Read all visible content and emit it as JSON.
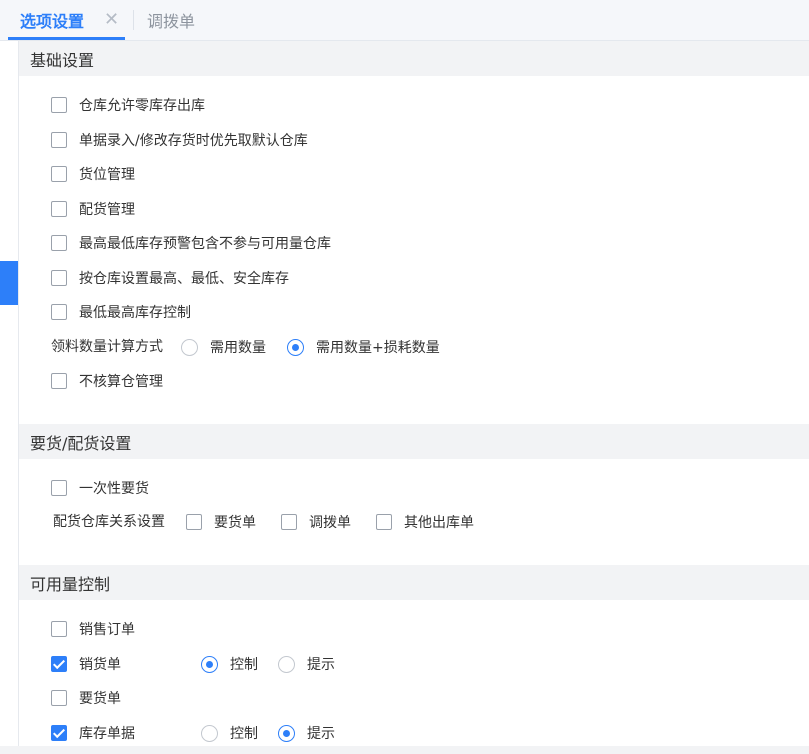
{
  "tabs": [
    {
      "label": "选项设置",
      "close": "✕",
      "active": true
    },
    {
      "label": "调拨单",
      "active": false
    }
  ],
  "sections": {
    "basic": {
      "title": "基础设置",
      "items": [
        {
          "label": "仓库允许零库存出库",
          "checked": false
        },
        {
          "label": "单据录入/修改存货时优先取默认仓库",
          "checked": false
        },
        {
          "label": "货位管理",
          "checked": false
        },
        {
          "label": "配货管理",
          "checked": false
        },
        {
          "label": "最高最低库存预警包含不参与可用量仓库",
          "checked": false
        },
        {
          "label": "按仓库设置最高、最低、安全库存",
          "checked": false
        },
        {
          "label": "最低最高库存控制",
          "checked": false
        }
      ],
      "calc_method": {
        "label": "领料数量计算方式",
        "options": [
          {
            "label": "需用数量",
            "selected": false
          },
          {
            "label": "需用数量+损耗数量",
            "selected": true
          }
        ]
      },
      "no_warehouse": {
        "label": "不核算仓管理",
        "checked": false
      }
    },
    "requisition": {
      "title": "要货/配货设置",
      "one_time": {
        "label": "一次性要货",
        "checked": false
      },
      "relation": {
        "label": "配货仓库关系设置",
        "options": [
          {
            "label": "要货单",
            "checked": false
          },
          {
            "label": "调拨单",
            "checked": false
          },
          {
            "label": "其他出库单",
            "checked": false
          }
        ]
      }
    },
    "availability": {
      "title": "可用量控制",
      "items": [
        {
          "label": "销售订单",
          "checked": false
        },
        {
          "label": "销货单",
          "checked": true,
          "mode": [
            {
              "label": "控制",
              "selected": true
            },
            {
              "label": "提示",
              "selected": false
            }
          ]
        },
        {
          "label": "要货单",
          "checked": false
        },
        {
          "label": "库存单据",
          "checked": true,
          "mode": [
            {
              "label": "控制",
              "selected": false
            },
            {
              "label": "提示",
              "selected": true
            }
          ]
        }
      ]
    }
  },
  "colors": {
    "accent": "#2d7ff9",
    "section_bg": "#f2f3f5",
    "tab_bg": "#f5f7fa"
  }
}
